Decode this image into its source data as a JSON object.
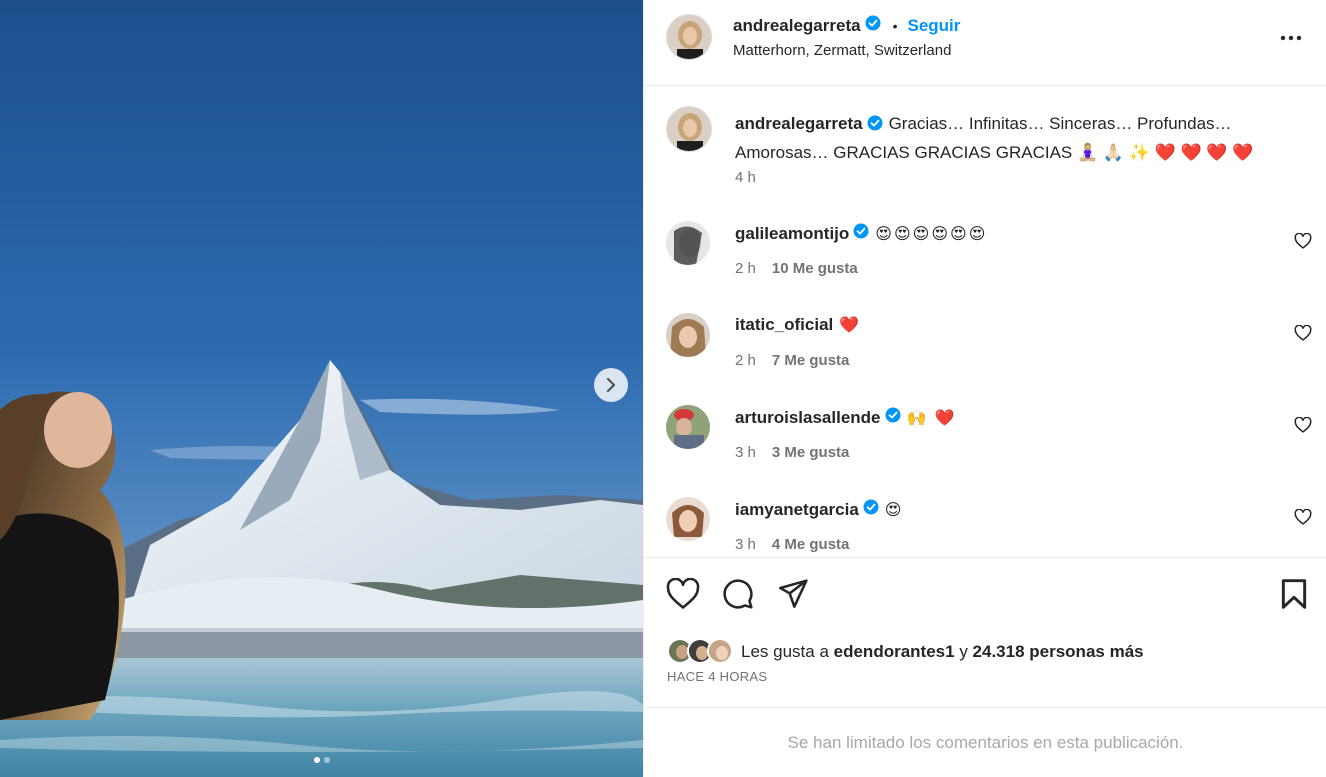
{
  "post": {
    "author": "andrealegarreta",
    "follow_label": "Seguir",
    "separator": "•",
    "location": "Matterhorn, Zermatt, Switzerland",
    "more_icon": "more-horizontal-icon",
    "caption": {
      "author": "andrealegarreta",
      "line1": "Gracias… Infinitas… Sinceras… Profundas…",
      "line2": "Amorosas… GRACIAS GRACIAS GRACIAS 🧘🏼‍♀️ 🙏🏻 ✨ ❤️ ❤️ ❤️ ❤️",
      "time": "4 h"
    }
  },
  "comments": [
    {
      "user": "galileamontijo",
      "verified": true,
      "text": "😍😍😍😍😍😍",
      "time": "2 h",
      "likes": "10 Me gusta"
    },
    {
      "user": "itatic_oficial",
      "verified": false,
      "text": "❤️",
      "time": "2 h",
      "likes": "7 Me gusta"
    },
    {
      "user": "arturoislasallende",
      "verified": true,
      "text": "🙌 ❤️",
      "time": "3 h",
      "likes": "3 Me gusta"
    },
    {
      "user": "iamyanetgarcia",
      "verified": true,
      "text": "😍",
      "time": "3 h",
      "likes": "4 Me gusta"
    }
  ],
  "actions": {
    "like_icon": "heart-icon",
    "comment_icon": "comment-icon",
    "share_icon": "send-icon",
    "save_icon": "bookmark-icon"
  },
  "likes_summary": {
    "prefix": "Les gusta a",
    "user": "edendorantes1",
    "conjunction": "y",
    "others": "24.318 personas más"
  },
  "posted_ago": "HACE 4 HORAS",
  "comments_limited": "Se han limitado los comentarios en esta publicación.",
  "carousel": {
    "current_index": 1,
    "total": 2,
    "next_icon": "chevron-right-icon"
  },
  "colors": {
    "accent": "#0095f6",
    "verified": "#0095f6",
    "heart": "#ed1c37",
    "muted": "#737373"
  }
}
